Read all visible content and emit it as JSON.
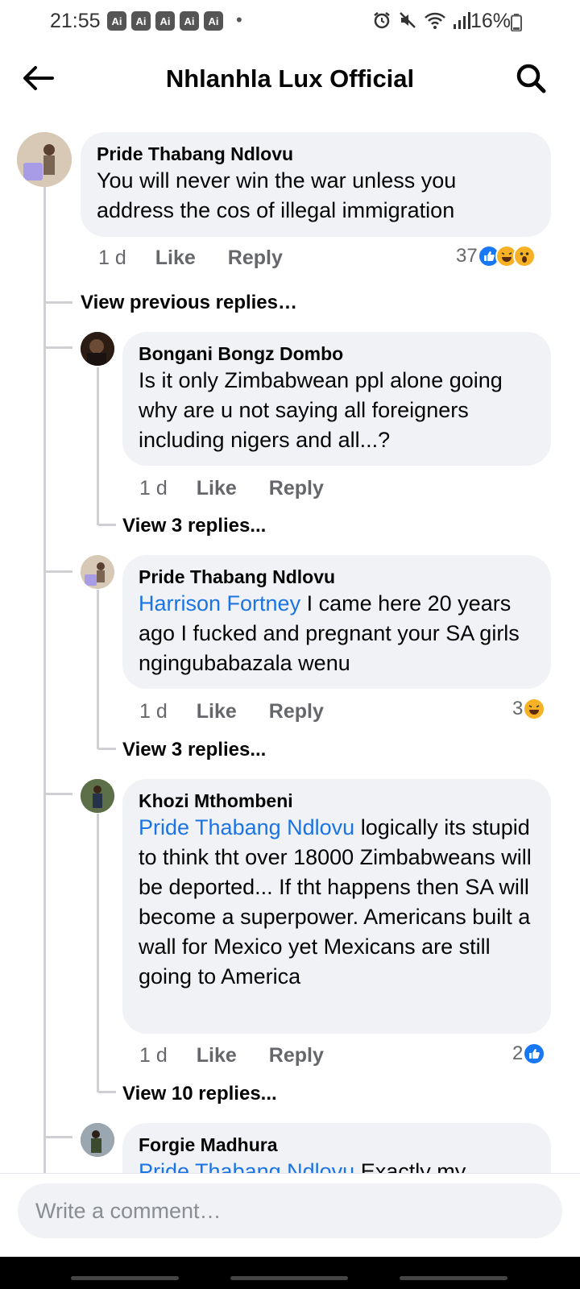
{
  "status_bar": {
    "time": "21:55",
    "ai_badges": [
      "Ai",
      "Ai",
      "Ai",
      "Ai",
      "Ai"
    ],
    "dot": "•",
    "battery": "16%",
    "icons": [
      "alarm-icon",
      "mute-icon",
      "wifi-icon",
      "signal-icon",
      "battery-icon"
    ]
  },
  "header": {
    "title": "Nhlanhla Lux Official",
    "back_icon": "back-arrow-icon",
    "search_icon": "search-icon"
  },
  "comments": [
    {
      "author": "Pride Thabang Ndlovu",
      "text": "You will never win the war unless you address the cos of illegal immigration",
      "time": "1 d",
      "like_label": "Like",
      "reply_label": "Reply",
      "reaction_count": "37",
      "reactions": [
        "like",
        "haha",
        "wow"
      ]
    }
  ],
  "view_previous": "View previous replies…",
  "replies": [
    {
      "author": "Bongani Bongz Dombo",
      "mention": "",
      "text": "Is it only Zimbabwean ppl alone going why are u not saying all foreigners including nigers and all...?",
      "time": "1 d",
      "like_label": "Like",
      "reply_label": "Reply",
      "view_replies": "View 3 replies..."
    },
    {
      "author": "Pride Thabang Ndlovu",
      "mention": "Harrison Fortney",
      "text": " I came here 20 years ago I fucked and  pregnant your SA girls ngingubabazala wenu",
      "time": "1 d",
      "like_label": "Like",
      "reply_label": "Reply",
      "reaction_count": "3",
      "reactions": [
        "haha"
      ],
      "view_replies": "View 3 replies..."
    },
    {
      "author": "Khozi Mthombeni",
      "mention": "Pride Thabang Ndlovu",
      "text": " logically its stupid to think tht over 18000 Zimbabweans will be deported... If tht happens then SA will become a superpower. Americans built a wall for Mexico yet Mexicans are still going to America",
      "time": "1 d",
      "like_label": "Like",
      "reply_label": "Reply",
      "reaction_count": "2",
      "reactions": [
        "like"
      ],
      "view_replies": "View 10 replies..."
    },
    {
      "author": "Forgie Madhura",
      "mention": "Pride Thabang Ndlovu",
      "text": " Exactly my"
    }
  ],
  "composer": {
    "placeholder": "Write a comment…"
  },
  "colors": {
    "mention": "#1b74e4",
    "like_blue": "#1877f2",
    "emoji_yellow": "#f7b125",
    "bubble": "#f0f2f5",
    "secondary_text": "#65676b"
  }
}
